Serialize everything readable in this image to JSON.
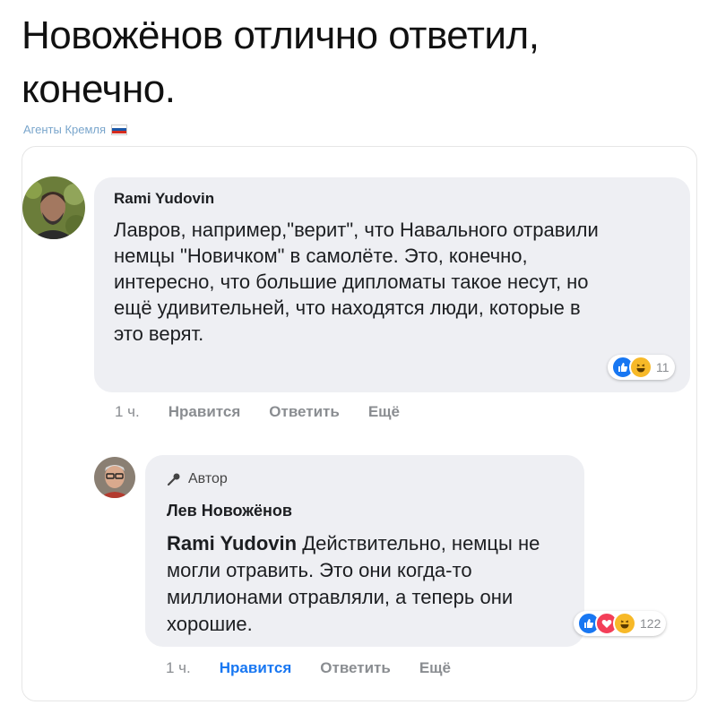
{
  "headline": "Новожёнов отлично ответил, конечно.",
  "source": {
    "label": "Агенты Кремля",
    "flag": [
      "#ffffff",
      "#1c57a7",
      "#d52b1e"
    ]
  },
  "comments": [
    {
      "author": "Rami Yudovin",
      "text": "Лавров, например,\"верит\", что Навального отравили немцы \"Новичком\" в самолёте. Это, конечно, интересно, что большие дипломаты такое несут, но ещё удивительней, что находятся люди, которые в это верят.",
      "reactions": {
        "icons": [
          "like-icon",
          "haha-icon"
        ],
        "count": "11"
      },
      "actions": {
        "time": "1 ч.",
        "like": "Нравится",
        "reply": "Ответить",
        "more": "Ещё"
      }
    },
    {
      "badge": "Автор",
      "author": "Лев Новожёнов",
      "mention": "Rami Yudovin",
      "text": "Действительно, немцы не могли отравить. Это они когда-то миллионами отравляли, а теперь они хорошие.",
      "reactions": {
        "icons": [
          "like-icon",
          "love-icon",
          "haha-icon"
        ],
        "count": "122"
      },
      "actions": {
        "time": "1 ч.",
        "like": "Нравится",
        "reply": "Ответить",
        "more": "Ещё"
      }
    }
  ],
  "colors": {
    "like": "#1877f2",
    "love": "#f33e58",
    "haha": "#f7b928",
    "bubble": "#eeeff3"
  }
}
